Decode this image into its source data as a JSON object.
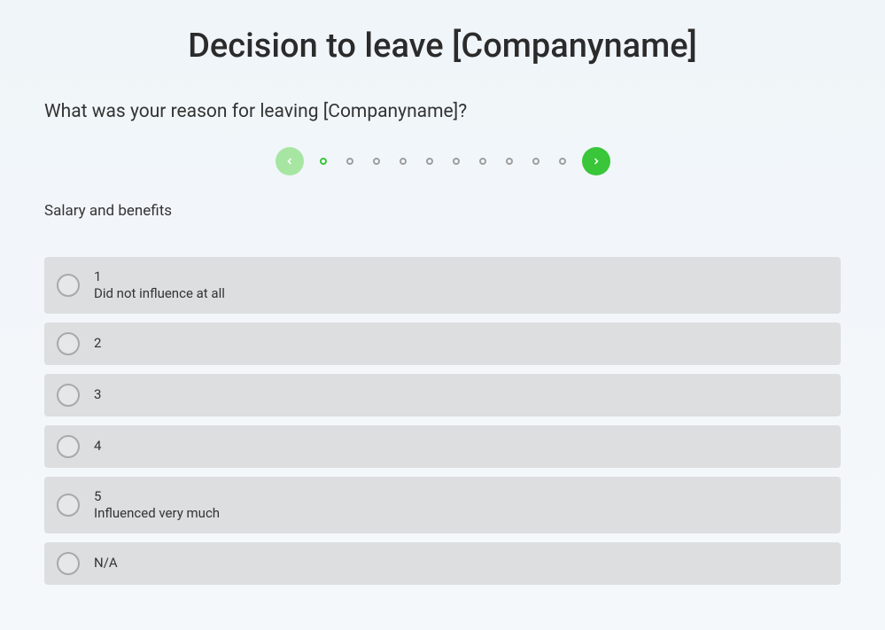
{
  "title": "Decision to leave [Companyname]",
  "question": "What was your reason for leaving [Companyname]?",
  "subtitle": "Salary and benefits",
  "pager": {
    "total": 10,
    "current": 0
  },
  "options": [
    {
      "value": "1",
      "label": "Did not influence at all"
    },
    {
      "value": "2",
      "label": ""
    },
    {
      "value": "3",
      "label": ""
    },
    {
      "value": "4",
      "label": ""
    },
    {
      "value": "5",
      "label": "Influenced very much"
    },
    {
      "value": "N/A",
      "label": ""
    }
  ]
}
